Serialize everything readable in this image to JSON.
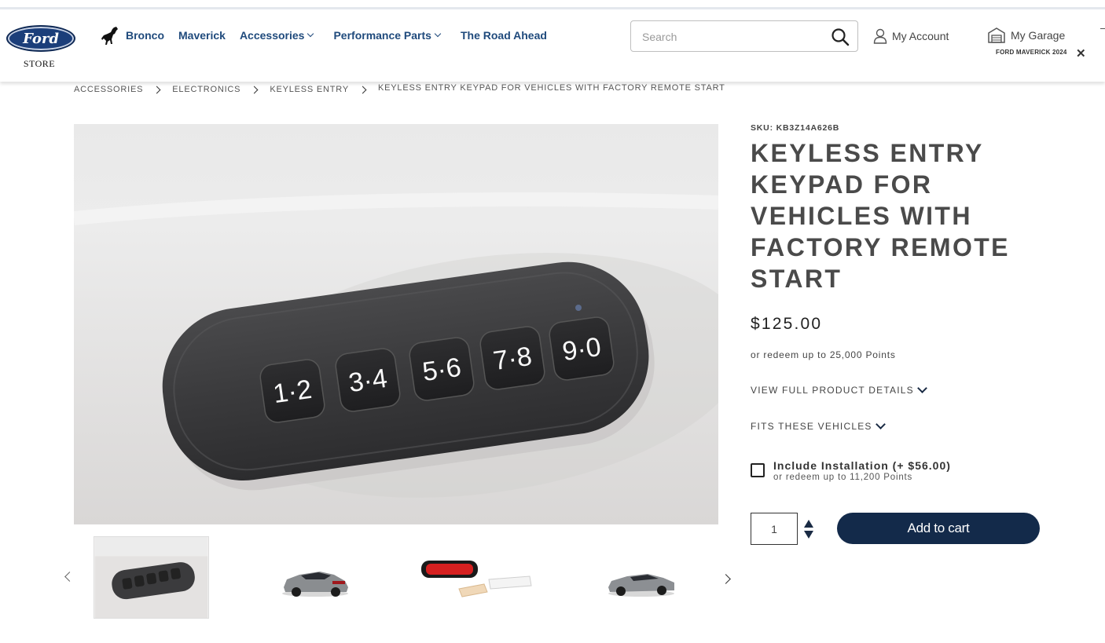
{
  "header": {
    "logo_text": "Ford",
    "logo_sub": "STORE",
    "nav": [
      {
        "label": "Bronco"
      },
      {
        "label": "Maverick"
      },
      {
        "label": "Accessories"
      },
      {
        "label": "Performance Parts"
      },
      {
        "label": "The Road Ahead"
      }
    ],
    "search_placeholder": "Search",
    "account_label": "My Account",
    "garage_label": "My Garage",
    "garage_vehicle": "FORD MAVERICK 2024",
    "garage_close": "✕"
  },
  "breadcrumb": [
    "ACCESSORIES",
    "ELECTRONICS",
    "KEYLESS ENTRY",
    "KEYLESS ENTRY KEYPAD FOR VEHICLES WITH FACTORY REMOTE START"
  ],
  "product": {
    "sku": "SKU: KB3Z14A626B",
    "title": "KEYLESS ENTRY KEYPAD FOR VEHICLES WITH FACTORY REMOTE START",
    "price": "$125.00",
    "redeem": "or redeem up to 25,000 Points",
    "details_label": "VIEW FULL PRODUCT DETAILS",
    "fits_label": "FITS THESE VEHICLES",
    "install_label": "Include Installation (+ $56.00)",
    "install_redeem": "or redeem up to 11,200 Points",
    "quantity": "1",
    "add_to_cart": "Add to cart",
    "keypad_buttons": [
      "1·2",
      "3·4",
      "5·6",
      "7·8",
      "9·0"
    ]
  },
  "thumbnails_visible": 4,
  "colors": {
    "nav_link": "#1f4a7c",
    "cart_button": "#132a4a",
    "logo_blue": "#1b3e7a"
  }
}
